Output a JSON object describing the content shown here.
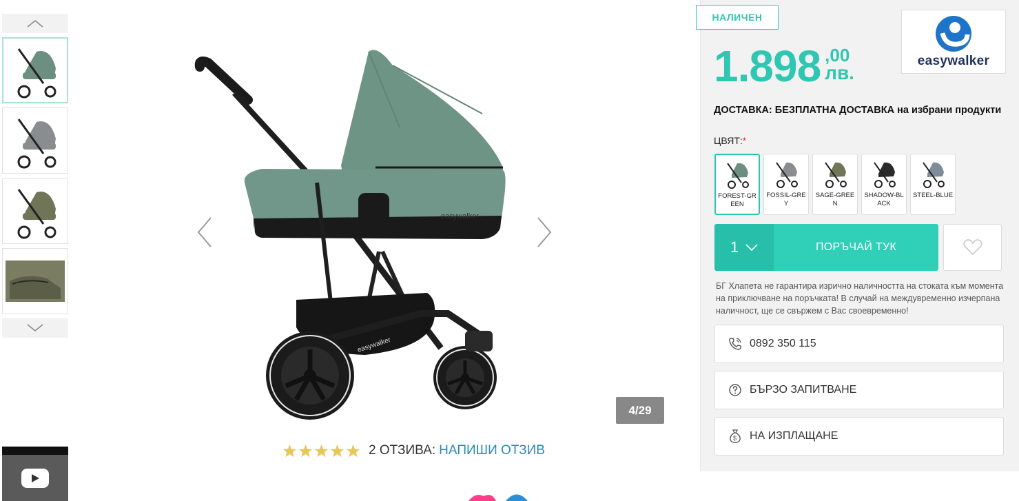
{
  "status_badge": "НАЛИЧЕН",
  "price": {
    "main": "1.898",
    "cents": ",00",
    "currency": "лв."
  },
  "brand": {
    "logo_text": "easywalker"
  },
  "delivery": "ДОСТАВКА: БЕЗПЛАТНА ДОСТАВКА на избрани продукти",
  "color": {
    "label": "ЦВЯТ:",
    "required_mark": "*",
    "options": [
      {
        "name": "FOREST-GREEN",
        "color": "#6d8f80",
        "selected": true
      },
      {
        "name": "FOSSIL-GREY",
        "color": "#8a8d90",
        "selected": false
      },
      {
        "name": "SAGE-GREEN",
        "color": "#6f7556",
        "selected": false
      },
      {
        "name": "SHADOW-BLACK",
        "color": "#2a2a2a",
        "selected": false
      },
      {
        "name": "STEEL-BLUE",
        "color": "#7d8b9a",
        "selected": false
      }
    ]
  },
  "order": {
    "quantity": "1",
    "button_label": "ПОРЪЧАЙ ТУК"
  },
  "disclaimer": "БГ Хлапета не гарантира изрично наличността на стоката към момента на приключване на поръчката! В случай на междувременно изчерпана наличност, ще се свържем с Вас своевременно!",
  "actions": {
    "phone": "0892 350 115",
    "quick_inquiry": "БЪРЗО ЗАПИТВАНЕ",
    "installments": "НА ИЗПЛАЩАНЕ"
  },
  "gallery": {
    "counter": "4/29",
    "thumbnails": [
      {
        "name": "forest-green",
        "color": "#6d8f80"
      },
      {
        "name": "fossil-grey",
        "color": "#8a8d90"
      },
      {
        "name": "sage-green",
        "color": "#6f7556"
      },
      {
        "name": "fabric-detail",
        "color": "#6f7556"
      }
    ]
  },
  "reviews": {
    "stars": 5,
    "count_label": "2 ОТЗИВА:",
    "write_link": "НАПИШИ ОТЗИВ"
  },
  "colors": {
    "accent": "#2fc7b2",
    "link": "#2a8bb5",
    "star": "#e8c75a"
  }
}
